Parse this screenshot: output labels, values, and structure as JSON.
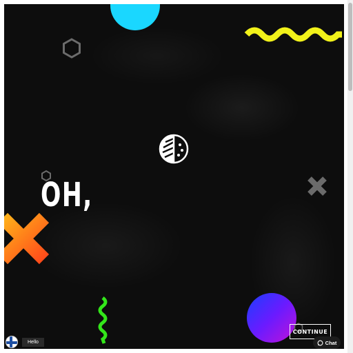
{
  "headline": "OH,",
  "buttons": {
    "continue_label": "CONTINUE",
    "chat_label": "Chat"
  },
  "language": {
    "greeting": "Hello"
  },
  "colors": {
    "background": "#0d0d0d",
    "cyan": "#1ad7ff",
    "yellow": "#f2f21a",
    "green": "#33e61a",
    "orange": "#ff8a1a",
    "accent_gray": "#6b6b6b"
  },
  "icons": [
    "hexagon-icon",
    "wave-icon",
    "pie-logo-icon",
    "cross-icon",
    "squiggle-icon",
    "chat-bubble-icon",
    "finland-flag-icon"
  ]
}
